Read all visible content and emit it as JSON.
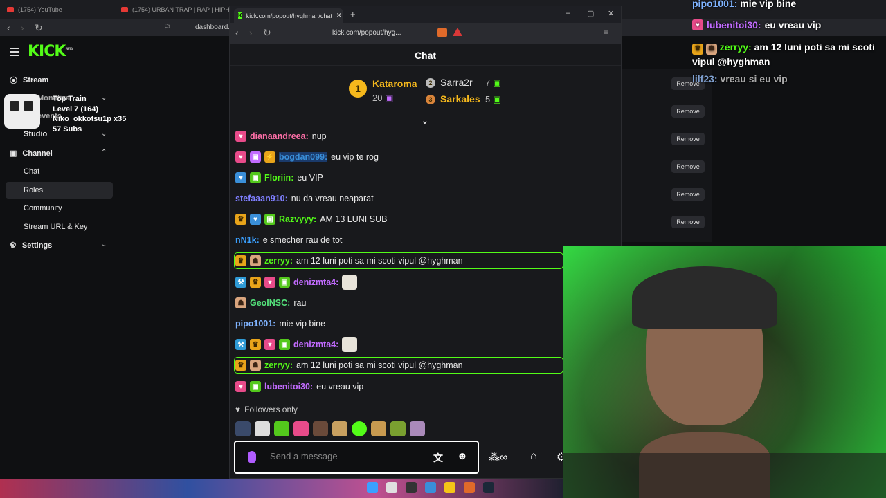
{
  "bg_browser": {
    "tabs": [
      "(1754) YouTube",
      "(1754) URBAN TRAP | RAP | HIPH"
    ],
    "url": "dashboard.k"
  },
  "dashboard": {
    "logo": "KICK",
    "logo_beta": "BETA",
    "sidebar": {
      "stream": "Stream",
      "monetization": "Monetiza",
      "events": "events",
      "studio": "Studio",
      "channel": "Channel",
      "chat": "Chat",
      "roles": "Roles",
      "community": "Community",
      "stream_url_key": "Stream URL & Key",
      "settings": "Settings"
    },
    "remove_label": "Remove"
  },
  "hype_train": {
    "title": "Top Train",
    "level": "Level 7  (164)",
    "top": "Niko_okkotsu1p x35",
    "subs": "57 Subs"
  },
  "overlay_chat": [
    {
      "user": "pipo1001:",
      "text": "mie vip bine",
      "color": "#7fb3ff"
    },
    {
      "user": "lubenitoi30:",
      "text": "eu vreau vip",
      "color": "#c26bff"
    },
    {
      "user": "zerryy:",
      "text": "am 12 luni poti sa mi scoti vipul @hyghman",
      "color": "#53fc18"
    },
    {
      "user": "lilf23:",
      "text": "vreau si eu vip",
      "color": "#7fa0d0"
    }
  ],
  "popout": {
    "tab_title": "kick.com/popout/hyghman/chat",
    "url": "kick.com/popout/hyg...",
    "header": "Chat",
    "leaderboard": [
      {
        "rank": "1",
        "name": "Kataroma",
        "count": "20"
      },
      {
        "rank": "2",
        "name": "Sarra2r",
        "count": "7"
      },
      {
        "rank": "3",
        "name": "Sarkales",
        "count": "5"
      }
    ],
    "messages": [
      {
        "user": "dianaandreea:",
        "text": "nup",
        "color": "#ff6fa8"
      },
      {
        "user": "bogdan099:",
        "text": "eu vip te rog",
        "color": "#3a8fd9"
      },
      {
        "user": "Floriin:",
        "text": "eu VIP",
        "color": "#53fc18"
      },
      {
        "user": "stefaaan910:",
        "text": "nu da vreau neaparat",
        "color": "#7f7fff"
      },
      {
        "user": "Razvyyy:",
        "text": "AM 13 LUNI SUB",
        "color": "#53fc18"
      },
      {
        "user": "nN1k:",
        "text": "e smecher rau de tot",
        "color": "#3aa0ff"
      },
      {
        "user": "zerryy:",
        "text": "am 12 luni poti sa mi scoti vipul @hyghman",
        "color": "#53fc18"
      },
      {
        "user": "denizmta4:",
        "text": "",
        "color": "#c26bff"
      },
      {
        "user": "GeoINSC:",
        "text": "rau",
        "color": "#53e07a"
      },
      {
        "user": "pipo1001:",
        "text": "mie vip bine",
        "color": "#7fb3ff"
      },
      {
        "user": "denizmta4:",
        "text": "",
        "color": "#c26bff"
      },
      {
        "user": "zerryy:",
        "text": "am 12 luni poti sa mi scoti vipul @hyghman",
        "color": "#53fc18"
      },
      {
        "user": "lubenitoi30:",
        "text": "eu vreau vip",
        "color": "#c26bff"
      }
    ],
    "followers_only": "Followers only",
    "send_placeholder": "Send a message"
  },
  "colors": {
    "accent": "#53fc18",
    "bg": "#18191c"
  },
  "icons": [
    "hamburger-icon",
    "mic-icon",
    "emoji-icon",
    "gift-icon",
    "heart-icon"
  ]
}
